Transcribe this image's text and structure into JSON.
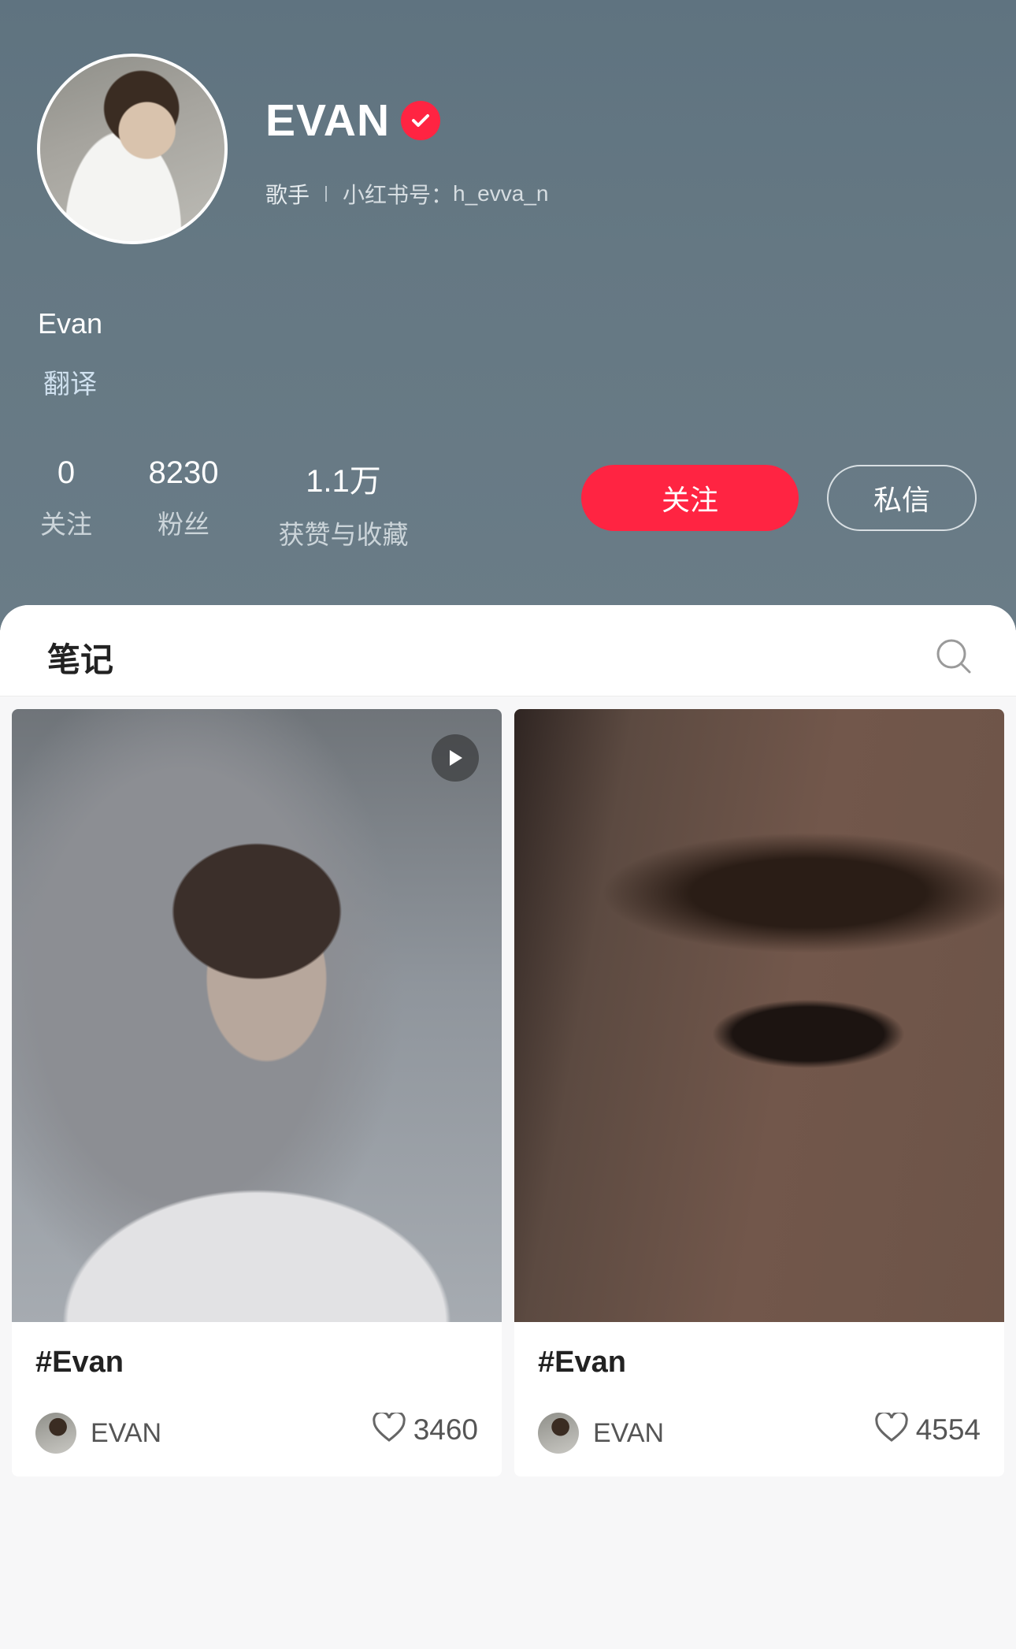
{
  "profile": {
    "display_name": "EVAN",
    "occupation": "歌手",
    "id_label": "小红书号：",
    "id_value": "h_evva_n",
    "bio_name": "Evan",
    "translate": "翻译"
  },
  "stats": {
    "following_count": "0",
    "following_label": "关注",
    "followers_count": "8230",
    "followers_label": "粉丝",
    "likes_count": "1.1万",
    "likes_label": "获赞与收藏"
  },
  "actions": {
    "follow": "关注",
    "message": "私信"
  },
  "tabs": {
    "notes": "笔记"
  },
  "notes": [
    {
      "title": "#Evan",
      "author": "EVAN",
      "likes": "3460",
      "is_video": true
    },
    {
      "title": "#Evan",
      "author": "EVAN",
      "likes": "4554",
      "is_video": false
    }
  ],
  "colors": {
    "accent": "#ff2442",
    "header_bg": "#657883"
  },
  "icons": [
    "verified-badge-icon",
    "search-icon",
    "play-icon",
    "heart-icon"
  ]
}
